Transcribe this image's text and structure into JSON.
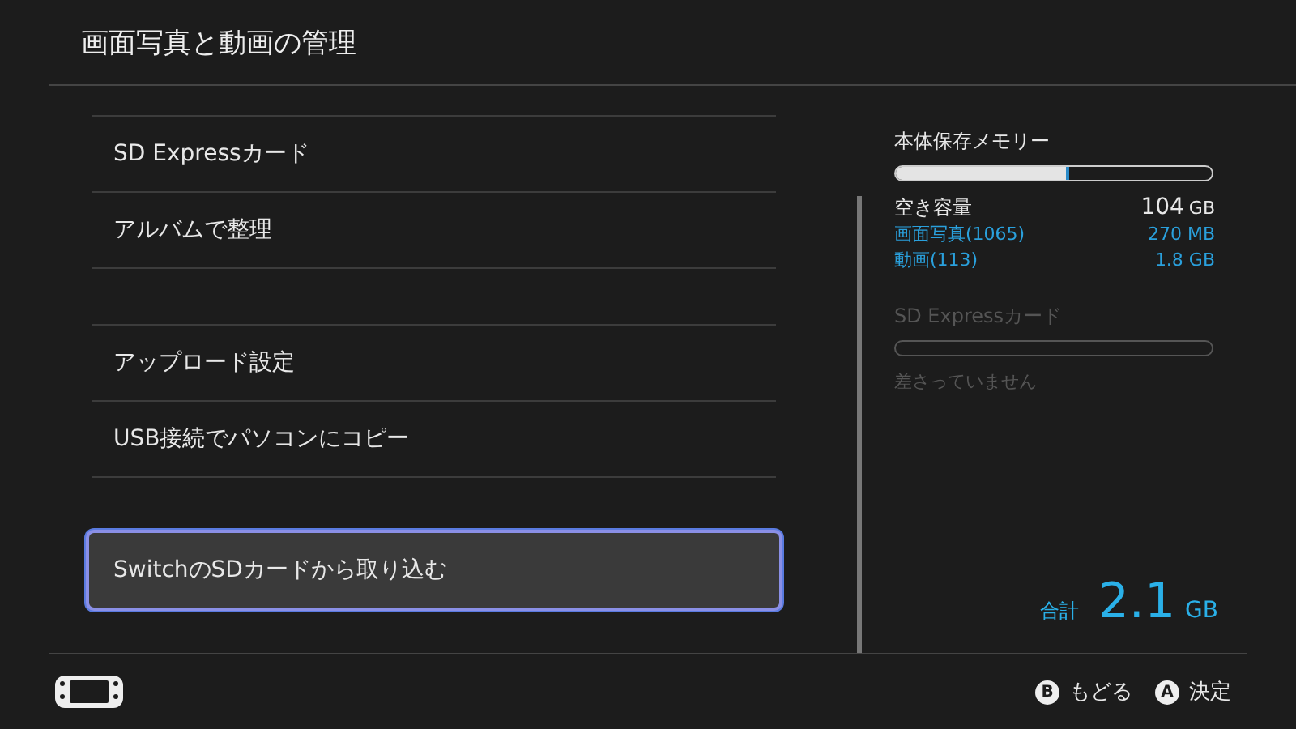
{
  "header": {
    "title": "画面写真と動画の管理"
  },
  "menu": [
    {
      "kind": "item",
      "label": "SD Expressカード",
      "selected": false
    },
    {
      "kind": "item",
      "label": "アルバムで整理",
      "selected": false
    },
    {
      "kind": "gap"
    },
    {
      "kind": "item",
      "label": "アップロード設定",
      "selected": false
    },
    {
      "kind": "item",
      "label": "USB接続でパソコンにコピー",
      "selected": false
    },
    {
      "kind": "gap"
    },
    {
      "kind": "item",
      "label": "SwitchのSDカードから取り込む",
      "selected": true
    }
  ],
  "storage": {
    "title": "本体保存メモリー",
    "level": 0.55,
    "free_label": "空き容量",
    "free_value": "104",
    "free_unit": "GB",
    "details": [
      {
        "label": "画面写真(1065)",
        "value": "270 MB"
      },
      {
        "label": "動画(113)",
        "value": "1.8 GB"
      }
    ]
  },
  "sd_card": {
    "title": "SD Expressカード",
    "disabled": true,
    "status": "差さっていません"
  },
  "total": {
    "label": "合計",
    "value": "2.1",
    "unit": "GB"
  },
  "footer": {
    "buttons": [
      {
        "key": "B",
        "label": "もどる"
      },
      {
        "key": "A",
        "label": "決定"
      }
    ]
  }
}
